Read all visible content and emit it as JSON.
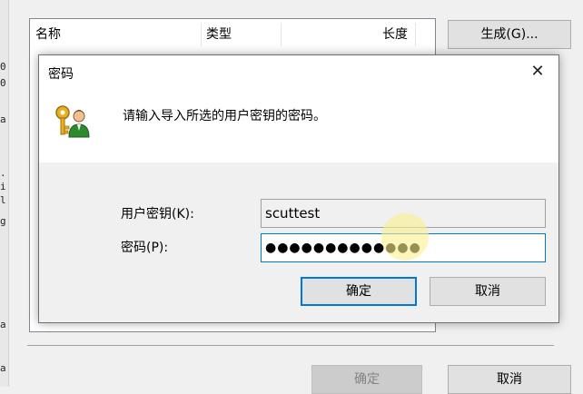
{
  "terminal": {
    "chars": [
      "0",
      "0",
      "a",
      ".",
      "i",
      "l",
      "g",
      "a",
      "a"
    ]
  },
  "bg_window": {
    "columns": [
      "名称",
      "类型",
      "长度"
    ],
    "generate_button": "生成(G)...",
    "ok_button": "确定",
    "cancel_button": "取消"
  },
  "dialog": {
    "title": "密码",
    "close_glyph": "✕",
    "message": "请输入导入所选的用户密钥的密码。",
    "user_key_label": "用户密钥(K):",
    "user_key_value": "scuttest",
    "password_label": "密码(P):",
    "password_value": "●●●●●●●●●●●●●",
    "ok_button": "确定",
    "cancel_button": "取消"
  },
  "icons": {
    "dialog_icon": "user-key-icon"
  }
}
